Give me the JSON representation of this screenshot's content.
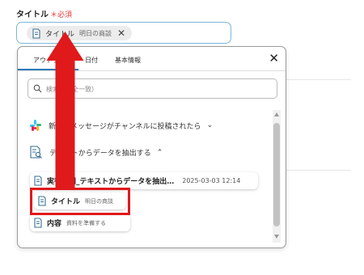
{
  "field": {
    "label": "タイトル",
    "required": "＊必須"
  },
  "input": {
    "chip_label": "タイトル",
    "chip_sub": "明日の商談",
    "remove_glyph": "✕"
  },
  "popup": {
    "tabs": [
      "アウトプット",
      "日付",
      "基本情報"
    ],
    "close_glyph": "✕",
    "search_placeholder": "検索（完全一致）",
    "sections": [
      {
        "label": "新しいメッセージがチャンネルに投稿されたら",
        "chevron": "⌄",
        "icon": "slack-icon"
      },
      {
        "label": "テキストからデータを抽出する",
        "chevron": "⌃",
        "icon": "document-search-icon"
      }
    ],
    "items": [
      {
        "label": "実行時間_テキストからデータを抽出…",
        "date": "2025-03-03 12:14"
      },
      {
        "label": "タイトル",
        "sub": "明日の商談"
      },
      {
        "label": "内容",
        "sub": "資料を準備する"
      }
    ]
  },
  "colors": {
    "accent": "#2e7ab6",
    "required": "#e53935",
    "annotation": "#e0191b",
    "input_border": "#7db7d9"
  }
}
